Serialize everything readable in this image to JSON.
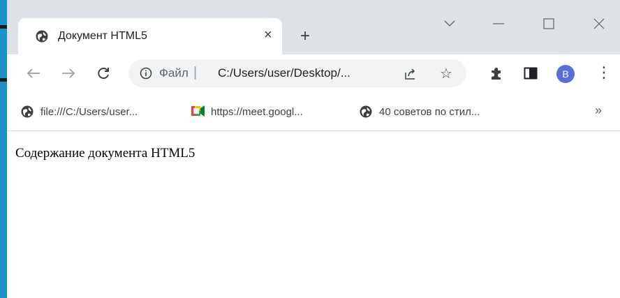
{
  "tab": {
    "title": "Документ HTML5",
    "close_label": "×",
    "new_tab_label": "+",
    "favicon": "globe-icon"
  },
  "window_controls": {
    "dropdown": "chevron-down-icon",
    "minimize": "minimize-icon",
    "maximize": "maximize-icon",
    "close": "close-icon"
  },
  "toolbar": {
    "back": "back-arrow-icon",
    "forward": "forward-arrow-icon",
    "reload": "reload-icon",
    "extensions": "puzzle-icon",
    "side_panel": "side-panel-icon",
    "menu_label": "⋮",
    "avatar_letter": "B"
  },
  "omnibox": {
    "label": "Файл",
    "separator": "|",
    "url": "C:/Users/user/Desktop/...",
    "info_icon": "info-icon",
    "share_icon": "share-icon",
    "star_label": "☆"
  },
  "bookmarks": {
    "items": [
      {
        "label": "file:///C:/Users/user...",
        "icon": "globe-icon"
      },
      {
        "label": "https://meet.googl...",
        "icon": "google-meet-icon"
      },
      {
        "label": "40 советов по стил...",
        "icon": "globe-icon"
      }
    ],
    "more_label": "»"
  },
  "page": {
    "text": "Содержание документа HTML5"
  },
  "colors": {
    "tabstrip_bg": "#dee1e6",
    "omnibox_bg": "#f1f3f4",
    "avatar_bg": "#5a6fd6",
    "left_strip": "#1e90c8"
  }
}
